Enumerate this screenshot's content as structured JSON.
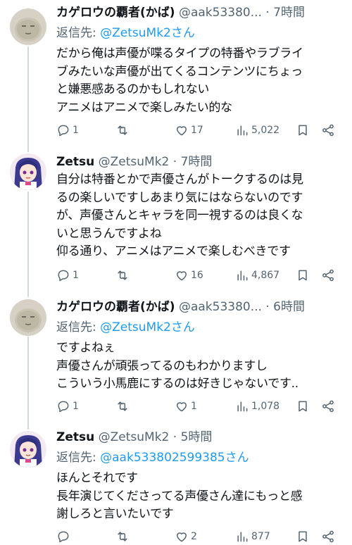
{
  "tweets": [
    {
      "name": "カゲロウの覇者(かば)",
      "handle": "@aak53380...",
      "dot": "·",
      "time": "7時間",
      "reply_to_label": "返信先: ",
      "reply_to_mention": "@ZetsuMk2さん",
      "lines": [
        "だから俺は声優が喋るタイプの特番やラブライ",
        "ブみたいな声優が出てくるコンテンツにちょっ",
        "と嫌悪感あるのかもしれない",
        "アニメはアニメで楽しみたい的な"
      ],
      "replies": "1",
      "retweets": "",
      "likes": "17",
      "views": "5,022"
    },
    {
      "name": "Zetsu",
      "handle": "@ZetsuMk2",
      "dot": "·",
      "time": "7時間",
      "lines": [
        "自分は特番とかで声優さんがトークするのは見",
        "るの楽しいですしあまり気にはならないのです",
        "が、声優さんとキャラを同一視するのは良くな",
        "いと思うんですよね",
        "仰る通り、アニメはアニメで楽しむべきです"
      ],
      "replies": "1",
      "retweets": "",
      "likes": "16",
      "views": "4,867"
    },
    {
      "name": "カゲロウの覇者(かば)",
      "handle": "@aak53380...",
      "dot": "·",
      "time": "6時間",
      "reply_to_label": "返信先: ",
      "reply_to_mention": "@ZetsuMk2さん",
      "lines": [
        "ですよねぇ",
        "声優さんが頑張ってるのもわかりますし",
        "こういう小馬鹿にするのは好きじゃないです.."
      ],
      "replies": "1",
      "retweets": "",
      "likes": "1",
      "views": "1,078"
    },
    {
      "name": "Zetsu",
      "handle": "@ZetsuMk2",
      "dot": "·",
      "time": "5時間",
      "reply_to_label": "返信先: ",
      "reply_to_mention": "@aak533802599385さん",
      "lines": [
        "ほんとそれです",
        "長年演じてくださってる声優さん達にもっと感",
        "謝しろと言いたいです"
      ],
      "replies": "",
      "retweets": "",
      "likes": "2",
      "views": "877"
    }
  ],
  "icons": {
    "reply": "reply-icon",
    "retweet": "retweet-icon",
    "like": "heart-icon",
    "views": "views-icon",
    "bookmark": "bookmark-icon",
    "share": "share-icon"
  },
  "colors": {
    "text": "#0f1419",
    "secondary": "#536471",
    "link": "#1d9bf0",
    "thread_line": "#cfd9de"
  }
}
